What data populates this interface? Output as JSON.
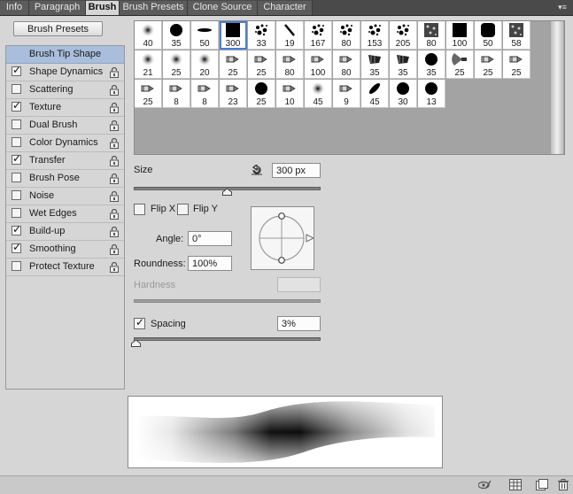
{
  "tabs": [
    {
      "label": "Info",
      "active": false
    },
    {
      "label": "Paragraph",
      "active": false
    },
    {
      "label": "Brush",
      "active": true
    },
    {
      "label": "Brush Presets",
      "active": false
    },
    {
      "label": "Clone Source",
      "active": false
    },
    {
      "label": "Character",
      "active": false
    }
  ],
  "panel_menu_icon": "panel-menu-icon",
  "brush_presets_button": "Brush Presets",
  "options": [
    {
      "label": "Brush Tip Shape",
      "header": true
    },
    {
      "label": "Shape Dynamics",
      "checked": true,
      "locked": true
    },
    {
      "label": "Scattering",
      "checked": false,
      "locked": true
    },
    {
      "label": "Texture",
      "checked": true,
      "locked": true
    },
    {
      "label": "Dual Brush",
      "checked": false,
      "locked": true
    },
    {
      "label": "Color Dynamics",
      "checked": false,
      "locked": true
    },
    {
      "label": "Transfer",
      "checked": true,
      "locked": true
    },
    {
      "label": "Brush Pose",
      "checked": false,
      "locked": true
    },
    {
      "label": "Noise",
      "checked": false,
      "locked": true
    },
    {
      "label": "Wet Edges",
      "checked": false,
      "locked": true
    },
    {
      "label": "Build-up",
      "checked": true,
      "locked": true
    },
    {
      "label": "Smoothing",
      "checked": true,
      "locked": true
    },
    {
      "label": "Protect Texture",
      "checked": false,
      "locked": true
    }
  ],
  "brush_tips": [
    {
      "size": "40",
      "kind": "soft-round",
      "selected": false
    },
    {
      "size": "35",
      "kind": "hard-round",
      "selected": false
    },
    {
      "size": "50",
      "kind": "flat-ellipse",
      "selected": false
    },
    {
      "size": "300",
      "kind": "square",
      "selected": true
    },
    {
      "size": "33",
      "kind": "splatter",
      "selected": false
    },
    {
      "size": "19",
      "kind": "diagonal-stroke",
      "selected": false
    },
    {
      "size": "167",
      "kind": "splatter",
      "selected": false
    },
    {
      "size": "80",
      "kind": "splatter",
      "selected": false
    },
    {
      "size": "153",
      "kind": "splatter",
      "selected": false
    },
    {
      "size": "205",
      "kind": "splatter",
      "selected": false
    },
    {
      "size": "80",
      "kind": "texture",
      "selected": false
    },
    {
      "size": "100",
      "kind": "square",
      "selected": false
    },
    {
      "size": "50",
      "kind": "rounded-square",
      "selected": false
    },
    {
      "size": "58",
      "kind": "texture",
      "selected": false
    },
    {
      "size": "21",
      "kind": "soft-round",
      "selected": false
    },
    {
      "size": "25",
      "kind": "soft-round",
      "selected": false
    },
    {
      "size": "20",
      "kind": "soft-round",
      "selected": false
    },
    {
      "size": "25",
      "kind": "pencil",
      "selected": false
    },
    {
      "size": "25",
      "kind": "pencil",
      "selected": false
    },
    {
      "size": "80",
      "kind": "pencil",
      "selected": false
    },
    {
      "size": "100",
      "kind": "pencil",
      "selected": false
    },
    {
      "size": "80",
      "kind": "pencil",
      "selected": false
    },
    {
      "size": "35",
      "kind": "flat-brush",
      "selected": false
    },
    {
      "size": "35",
      "kind": "flat-brush",
      "selected": false
    },
    {
      "size": "35",
      "kind": "hard-round",
      "selected": false
    },
    {
      "size": "25",
      "kind": "fan-brush",
      "selected": false
    },
    {
      "size": "25",
      "kind": "pencil",
      "selected": false
    },
    {
      "size": "25",
      "kind": "pencil",
      "selected": false
    },
    {
      "size": "25",
      "kind": "pencil",
      "selected": false
    },
    {
      "size": "8",
      "kind": "pencil",
      "selected": false
    },
    {
      "size": "8",
      "kind": "pencil",
      "selected": false
    },
    {
      "size": "23",
      "kind": "pencil",
      "selected": false
    },
    {
      "size": "25",
      "kind": "hard-round",
      "selected": false
    },
    {
      "size": "10",
      "kind": "pencil",
      "selected": false
    },
    {
      "size": "45",
      "kind": "soft-round",
      "selected": false
    },
    {
      "size": "9",
      "kind": "pencil",
      "selected": false
    },
    {
      "size": "45",
      "kind": "angled-ellipse",
      "selected": false
    },
    {
      "size": "30",
      "kind": "hard-round",
      "selected": false
    },
    {
      "size": "13",
      "kind": "hard-round",
      "selected": false
    }
  ],
  "size": {
    "label": "Size",
    "value": "300 px",
    "slider": 0.5,
    "reset_icon": "reset-size-icon"
  },
  "flip_x": {
    "label": "Flip X",
    "checked": false
  },
  "flip_y": {
    "label": "Flip Y",
    "checked": false
  },
  "angle": {
    "label": "Angle:",
    "value": "0°"
  },
  "roundness": {
    "label": "Roundness:",
    "value": "100%"
  },
  "hardness": {
    "label": "Hardness",
    "value": "",
    "disabled": true
  },
  "spacing": {
    "label": "Spacing",
    "checked": true,
    "value": "3%",
    "slider": 0.01
  },
  "footer_icons": [
    "eye-brush-icon",
    "grid-panel-icon",
    "new-preset-icon",
    "trash-icon"
  ]
}
